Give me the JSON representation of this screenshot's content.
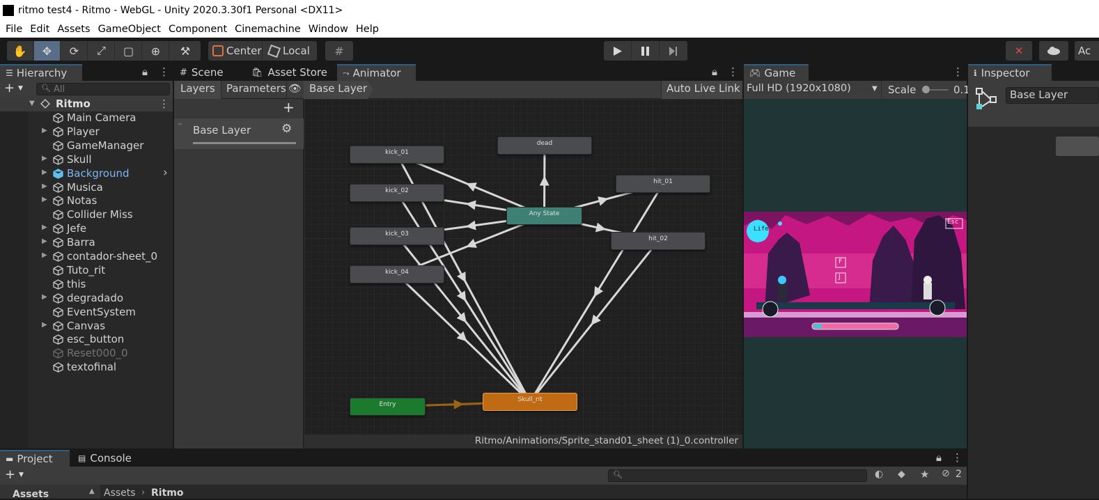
{
  "window": {
    "title": "ritmo test4 - Ritmo - WebGL - Unity 2020.3.30f1 Personal <DX11>"
  },
  "menu": [
    "File",
    "Edit",
    "Assets",
    "GameObject",
    "Component",
    "Cinemachine",
    "Window",
    "Help"
  ],
  "toolbar": {
    "pivot_label": "Center",
    "space_label": "Local",
    "account_label": "Ac"
  },
  "hierarchy": {
    "tab": "Hierarchy",
    "search_placeholder": "All",
    "scene_name": "Ritmo",
    "items": [
      {
        "label": "Main Camera",
        "expandable": false,
        "style": "normal"
      },
      {
        "label": "Player",
        "expandable": true,
        "style": "normal"
      },
      {
        "label": "GameManager",
        "expandable": false,
        "style": "normal"
      },
      {
        "label": "Skull",
        "expandable": true,
        "style": "normal"
      },
      {
        "label": "Background",
        "expandable": true,
        "style": "prefab"
      },
      {
        "label": "Musica",
        "expandable": true,
        "style": "normal"
      },
      {
        "label": "Notas",
        "expandable": true,
        "style": "normal"
      },
      {
        "label": "Collider Miss",
        "expandable": false,
        "style": "normal"
      },
      {
        "label": "Jefe",
        "expandable": true,
        "style": "normal"
      },
      {
        "label": "Barra",
        "expandable": true,
        "style": "normal"
      },
      {
        "label": "contador-sheet_0",
        "expandable": true,
        "style": "normal"
      },
      {
        "label": "Tuto_rit",
        "expandable": false,
        "style": "normal"
      },
      {
        "label": "this",
        "expandable": false,
        "style": "normal"
      },
      {
        "label": "degradado",
        "expandable": true,
        "style": "normal"
      },
      {
        "label": "EventSystem",
        "expandable": false,
        "style": "normal"
      },
      {
        "label": "Canvas",
        "expandable": true,
        "style": "normal"
      },
      {
        "label": "esc_button",
        "expandable": false,
        "style": "normal"
      },
      {
        "label": "Reset000_0",
        "expandable": false,
        "style": "disabled"
      },
      {
        "label": "textofinal",
        "expandable": false,
        "style": "normal"
      }
    ]
  },
  "center_tabs": [
    "Scene",
    "Asset Store",
    "Animator"
  ],
  "animator": {
    "layers_tab": "Layers",
    "parameters_tab": "Parameters",
    "breadcrumb": "Base Layer",
    "auto_live_link": "Auto Live Link",
    "layer_name": "Base Layer",
    "path": "Ritmo/Animations/Sprite_stand01_sheet (1)_0.controller",
    "states": [
      {
        "id": "kick_01",
        "label": "kick_01",
        "kind": "normal"
      },
      {
        "id": "kick_02",
        "label": "kick_02",
        "kind": "normal"
      },
      {
        "id": "kick_03",
        "label": "kick_03",
        "kind": "normal"
      },
      {
        "id": "kick_04",
        "label": "kick_04",
        "kind": "normal"
      },
      {
        "id": "dead",
        "label": "dead",
        "kind": "normal"
      },
      {
        "id": "hit_01",
        "label": "hit_01",
        "kind": "normal"
      },
      {
        "id": "hit_02",
        "label": "hit_02",
        "kind": "normal"
      },
      {
        "id": "any",
        "label": "Any State",
        "kind": "any"
      },
      {
        "id": "entry",
        "label": "Entry",
        "kind": "entry"
      },
      {
        "id": "skull",
        "label": "Skull_rit",
        "kind": "default"
      }
    ],
    "colors": {
      "any": "#3e8074",
      "entry": "#1c7a2e",
      "default": "#c06a14",
      "normal": "#4a4b4f",
      "transition": "#d8d8d8",
      "entry_transition": "#9a6414"
    }
  },
  "game": {
    "tab": "Game",
    "resolution": "Full HD (1920x1080)",
    "scale_label": "Scale",
    "scale_value": "0.1",
    "hud_life": "Life",
    "hud_esc": "Esc",
    "hud_key_f": "F",
    "hud_key_j": "J"
  },
  "inspector": {
    "tab": "Inspector",
    "object_name": "Base Layer"
  },
  "bottom": {
    "project_tab": "Project",
    "console_tab": "Console",
    "hidden_count": "2",
    "breadcrumb_root": "Assets",
    "breadcrumb_leaf": "Ritmo",
    "assets_label": "Assets"
  }
}
